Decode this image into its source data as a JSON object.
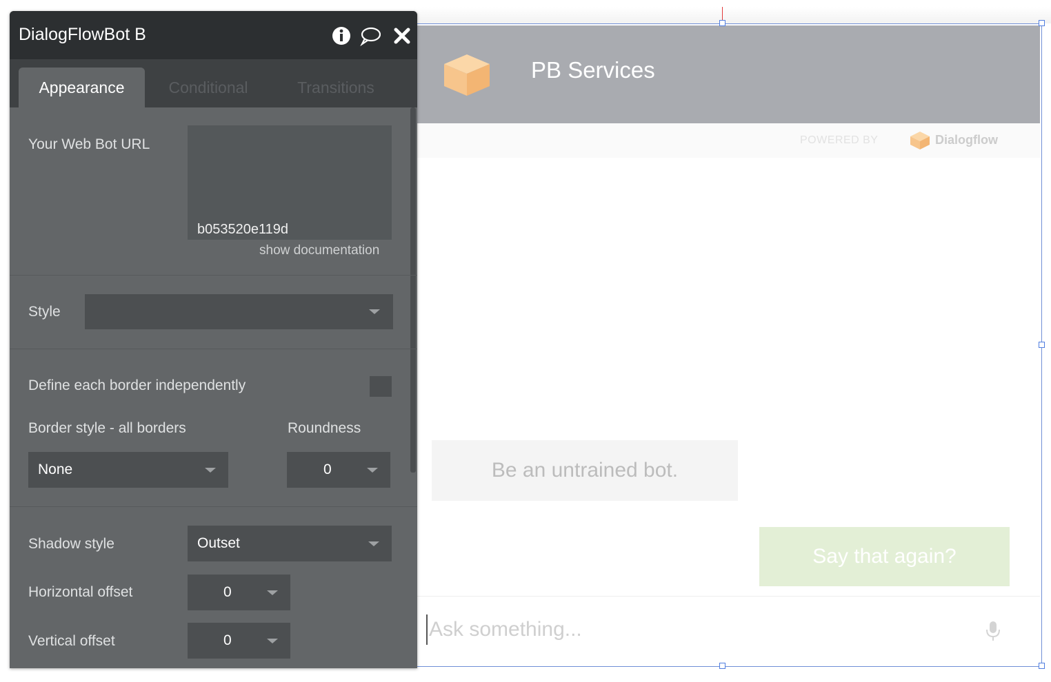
{
  "panel": {
    "title": "DialogFlowBot B",
    "tabs": [
      {
        "label": "Appearance"
      },
      {
        "label": "Conditional"
      },
      {
        "label": "Transitions"
      }
    ],
    "fields": {
      "url_label": "Your Web Bot URL",
      "url_value": "b053520e119d",
      "show_documentation": "show documentation",
      "style_label": "Style",
      "style_value": "",
      "border_independent_label": "Define each border independently",
      "border_style_label": "Border style - all borders",
      "border_style_value": "None",
      "roundness_label": "Roundness",
      "roundness_value": "0",
      "shadow_style_label": "Shadow style",
      "shadow_style_value": "Outset",
      "horizontal_offset_label": "Horizontal offset",
      "horizontal_offset_value": "0",
      "vertical_offset_label": "Vertical offset",
      "vertical_offset_value": "0"
    }
  },
  "chat": {
    "bot_name": "PB Services",
    "powered_by": "POWERED BY",
    "provider": "Dialogflow",
    "bot_message": "Be an untrained bot.",
    "user_message": "Say that again?",
    "input_placeholder": "Ask something..."
  },
  "colors": {
    "panel_bg": "#636668",
    "panel_header": "#2c2f31",
    "chat_header": "#a9abb0",
    "cube_orange": "#f7c58c",
    "user_bubble": "#e3efd6",
    "selection_blue": "#4f7de0"
  },
  "icons": [
    "info-icon",
    "comment-icon",
    "close-icon",
    "cube-icon",
    "dialogflow-logo-icon",
    "microphone-icon",
    "chevron-down-icon"
  ]
}
